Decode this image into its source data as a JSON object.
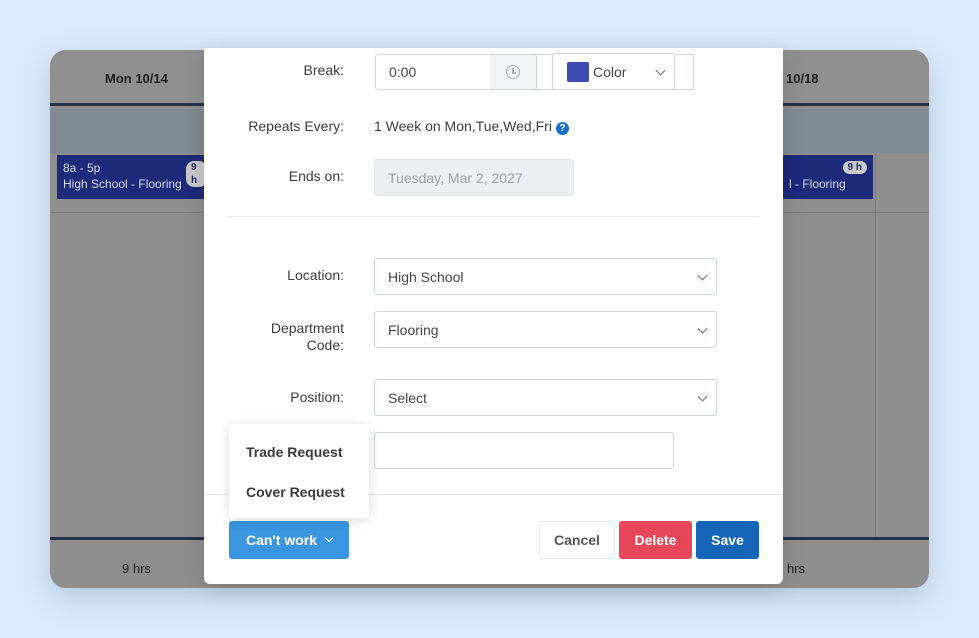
{
  "calendar": {
    "day_left": "Mon 10/14",
    "day_right": "10/18",
    "shift_left": {
      "time": "8a - 5p",
      "label": "High School - Flooring",
      "hours": "9 h"
    },
    "shift_right": {
      "label": "l - Flooring",
      "hours": "9 h"
    },
    "footer_left": "9 hrs",
    "footer_right": "hrs"
  },
  "form": {
    "break": {
      "label": "Break:",
      "value": "0:00",
      "icon": "clock-icon"
    },
    "color": {
      "label": "Color",
      "swatch": "#3f4ab0"
    },
    "repeats": {
      "label": "Repeats Every:",
      "value": "1 Week on Mon,Tue,Wed,Fri",
      "help": "?"
    },
    "ends_on": {
      "label": "Ends on:",
      "value": "Tuesday, Mar 2, 2027"
    },
    "location": {
      "label": "Location:",
      "value": "High School"
    },
    "department": {
      "label_line1": "Department",
      "label_line2": "Code:",
      "value": "Flooring"
    },
    "position": {
      "label": "Position:",
      "value": "Select"
    },
    "extra_input": {
      "value": ""
    }
  },
  "actions": {
    "cant_work": "Can't work",
    "cancel": "Cancel",
    "delete": "Delete",
    "save": "Save"
  },
  "cant_work_menu": {
    "items": [
      "Trade Request",
      "Cover Request"
    ]
  },
  "colors": {
    "accent_blue": "#3a96e0",
    "save_blue": "#1566b8",
    "delete_red": "#e8475b",
    "shift_navy": "#1e2a7a",
    "page_bg": "#dcebfb"
  }
}
